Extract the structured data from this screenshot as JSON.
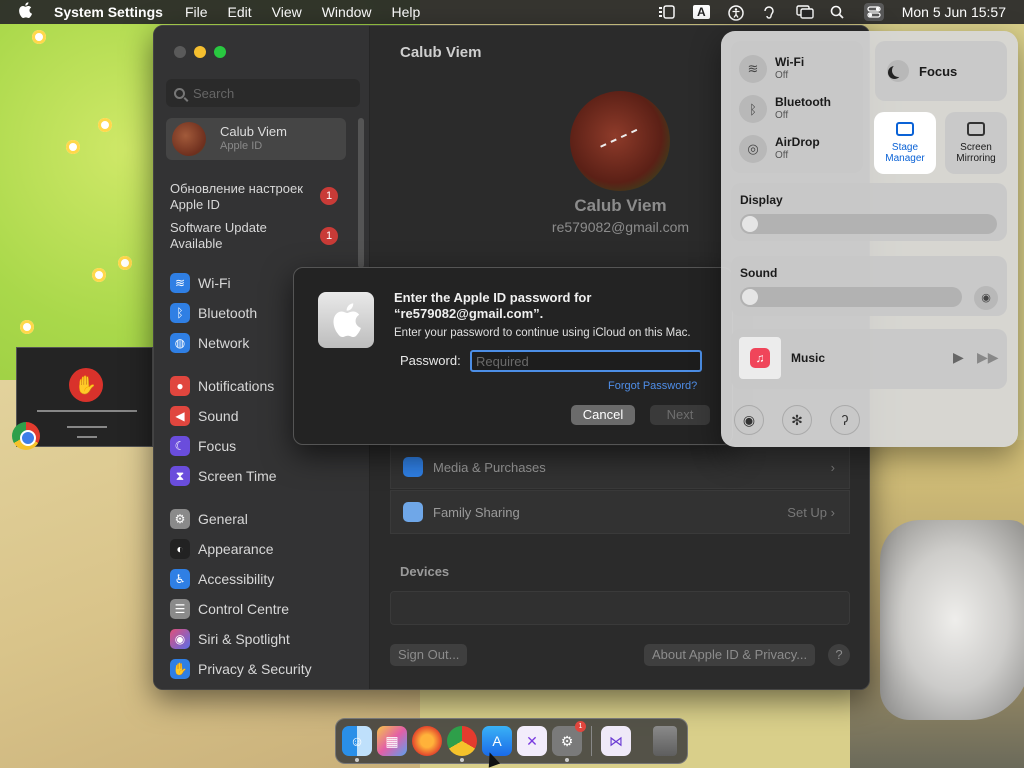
{
  "menubar": {
    "app": "System Settings",
    "menus": [
      "File",
      "Edit",
      "View",
      "Window",
      "Help"
    ],
    "kbd": "A",
    "datetime": "Mon 5 Jun  15:57"
  },
  "sidebar": {
    "search_placeholder": "Search",
    "profile_name": "Calub Viem",
    "profile_sub": "Apple ID",
    "updates": [
      {
        "label": "Обновление настроек Apple ID",
        "badge": "1"
      },
      {
        "label": "Software Update Available",
        "badge": "1"
      }
    ],
    "items": [
      {
        "label": "Wi-Fi",
        "color": "#2f7fe4"
      },
      {
        "label": "Bluetooth",
        "color": "#2f7fe4"
      },
      {
        "label": "Network",
        "color": "#2f7fe4"
      },
      {
        "label": "Notifications",
        "color": "#e0463e"
      },
      {
        "label": "Sound",
        "color": "#e0463e"
      },
      {
        "label": "Focus",
        "color": "#6a4ddc"
      },
      {
        "label": "Screen Time",
        "color": "#6a4ddc"
      },
      {
        "label": "General",
        "color": "#8a8a8a"
      },
      {
        "label": "Appearance",
        "color": "#222222"
      },
      {
        "label": "Accessibility",
        "color": "#2f7fe4"
      },
      {
        "label": "Control Centre",
        "color": "#8a8a8a"
      },
      {
        "label": "Siri & Spotlight",
        "color": "#c04fd8"
      },
      {
        "label": "Privacy & Security",
        "color": "#2f7fe4"
      }
    ]
  },
  "main": {
    "title": "Calub Viem",
    "name": "Calub Viem",
    "email": "re579082@gmail.com",
    "rows": [
      {
        "label": "Media & Purchases",
        "right": ""
      },
      {
        "label": "Family Sharing",
        "right": "Set Up"
      }
    ],
    "devices_title": "Devices",
    "sign_out": "Sign Out...",
    "about": "About Apple ID & Privacy...",
    "help": "?"
  },
  "dialog": {
    "title": "Enter the Apple ID password for “re579082@gmail.com”.",
    "subtitle": "Enter your password to continue using iCloud on this Mac.",
    "password_label": "Password:",
    "password_placeholder": "Required",
    "forgot": "Forgot Password?",
    "cancel": "Cancel",
    "next": "Next"
  },
  "control_centre": {
    "wifi": {
      "label": "Wi-Fi",
      "status": "Off"
    },
    "bluetooth": {
      "label": "Bluetooth",
      "status": "Off"
    },
    "airdrop": {
      "label": "AirDrop",
      "status": "Off"
    },
    "focus": "Focus",
    "stage_manager": "Stage Manager",
    "screen_mirroring": "Screen Mirroring",
    "display": "Display",
    "display_level": 0.05,
    "sound": "Sound",
    "sound_level": 0.05,
    "music": "Music"
  }
}
